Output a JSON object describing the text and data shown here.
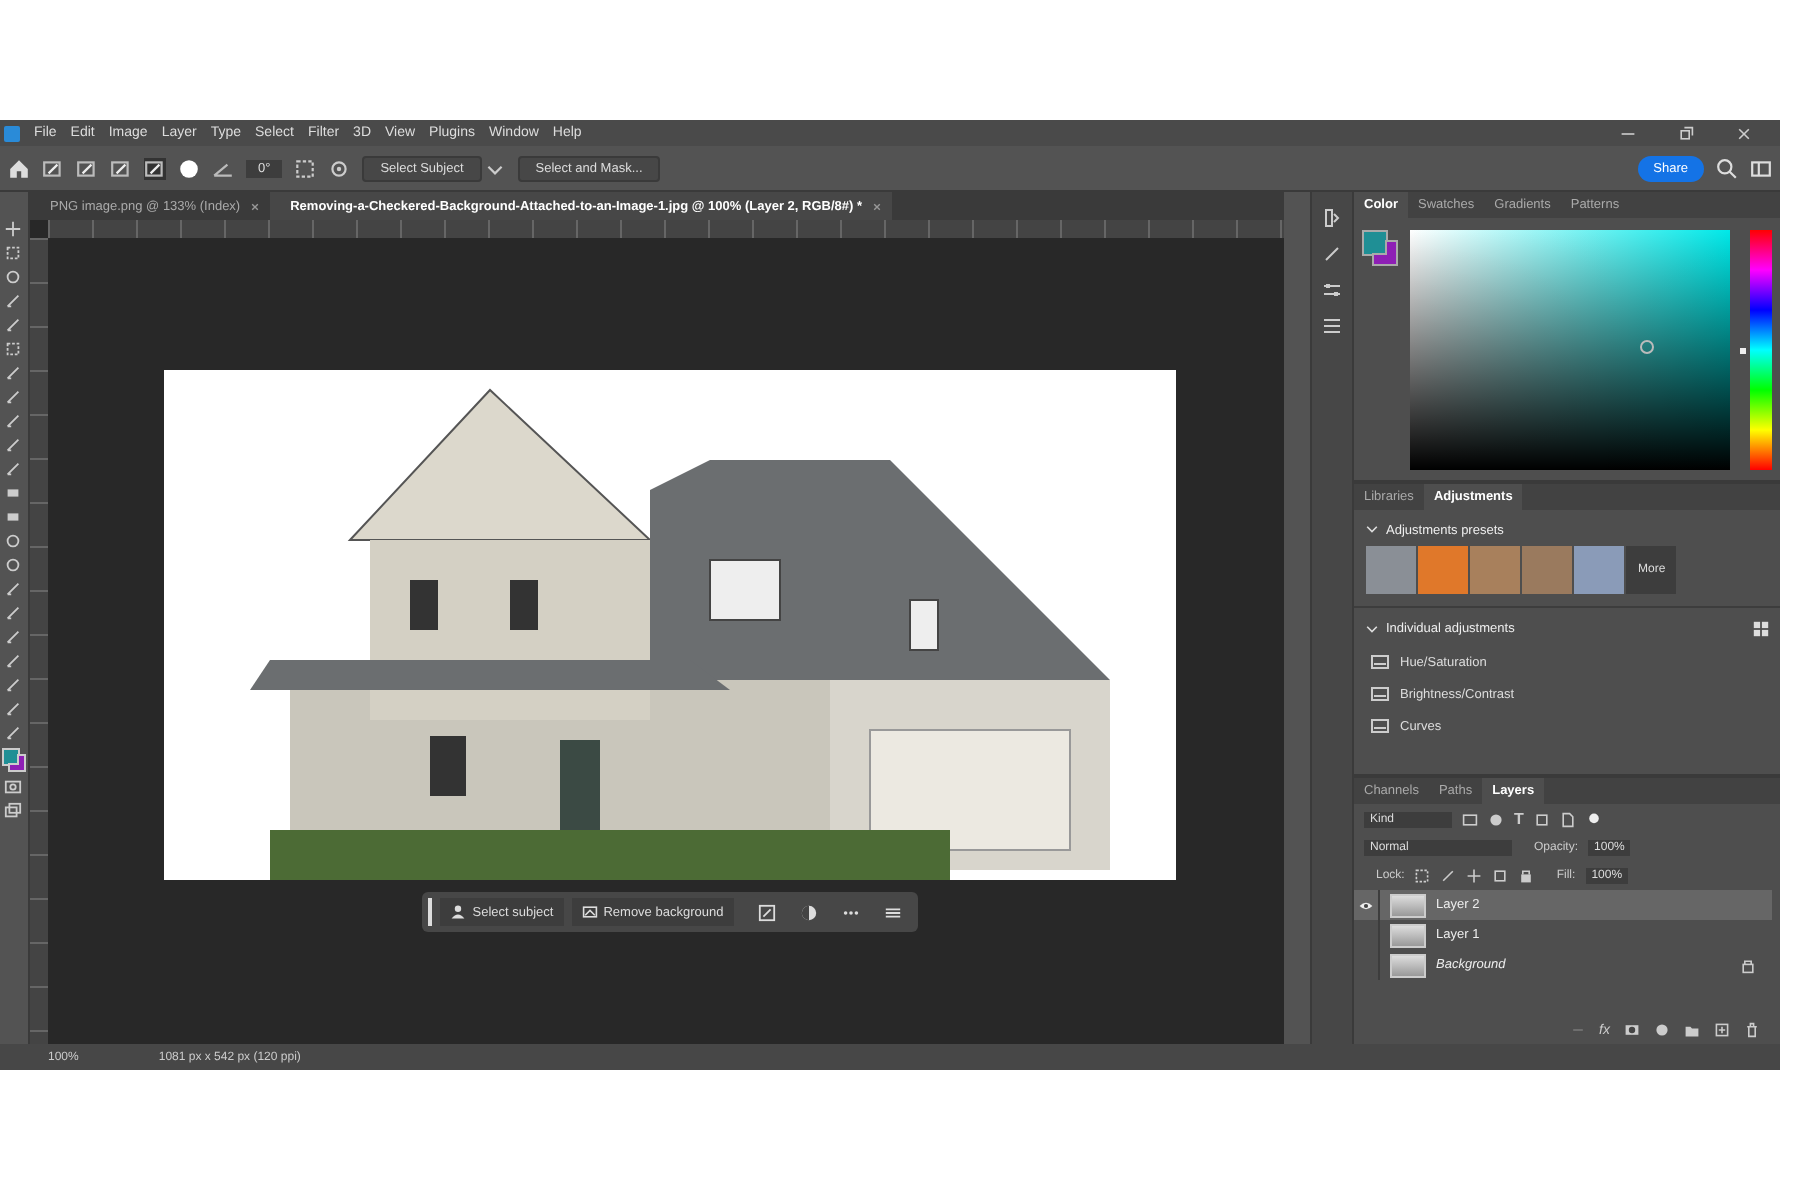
{
  "menu": [
    "File",
    "Edit",
    "Image",
    "Layer",
    "Type",
    "Select",
    "Filter",
    "3D",
    "View",
    "Plugins",
    "Window",
    "Help"
  ],
  "options_bar": {
    "angle": "0°",
    "select_subject": "Select Subject",
    "select_and_mask": "Select and Mask...",
    "share": "Share"
  },
  "doc_tabs": [
    {
      "label": "PNG image.png @ 133% (Index)",
      "selected": false
    },
    {
      "label": "Removing-a-Checkered-Background-Attached-to-an-Image-1.jpg @ 100% (Layer 2, RGB/8#) *",
      "selected": true
    }
  ],
  "contextual_bar": {
    "buttons": [
      "Select subject",
      "Remove background"
    ]
  },
  "status_bar": {
    "zoom": "100%",
    "size": "1081 px x 542 px (120 ppi)"
  },
  "color_panel": {
    "tabs": [
      {
        "label": "Color",
        "selected": true
      },
      {
        "label": "Swatches",
        "selected": false
      },
      {
        "label": "Gradients",
        "selected": false
      },
      {
        "label": "Patterns",
        "selected": false
      }
    ],
    "hue_slider": {
      "level": 0.5
    }
  },
  "adjustments_panel": {
    "tabs": [
      {
        "label": "Libraries",
        "selected": false
      },
      {
        "label": "Adjustments",
        "selected": true
      }
    ],
    "presets_title": "Adjustments presets",
    "presets": [
      {
        "color": "#8a8f96"
      },
      {
        "color": "#e0782a"
      },
      {
        "color": "#a8805c"
      },
      {
        "color": "#9a7a5e"
      },
      {
        "color": "#8a9bb8"
      }
    ],
    "more": "More",
    "individual_title": "Individual adjustments",
    "items": [
      "Hue/Saturation",
      "Brightness/Contrast",
      "Curves"
    ]
  },
  "layers_panel": {
    "tabs": [
      {
        "label": "Channels",
        "selected": false
      },
      {
        "label": "Paths",
        "selected": false
      },
      {
        "label": "Layers",
        "selected": true
      }
    ],
    "filter": "Kind",
    "type_filter": "T",
    "blend_mode": "Normal",
    "opacity_label": "Opacity:",
    "opacity": "100%",
    "lock_label": "Lock:",
    "fill_label": "Fill:",
    "fill": "100%",
    "fx": "fx",
    "layers": [
      {
        "name": "Layer 2",
        "selected": true,
        "visible": true,
        "locked": false
      },
      {
        "name": "Layer 1",
        "selected": false,
        "visible": false,
        "locked": false
      },
      {
        "name": "Background",
        "selected": false,
        "visible": false,
        "locked": true
      }
    ]
  }
}
